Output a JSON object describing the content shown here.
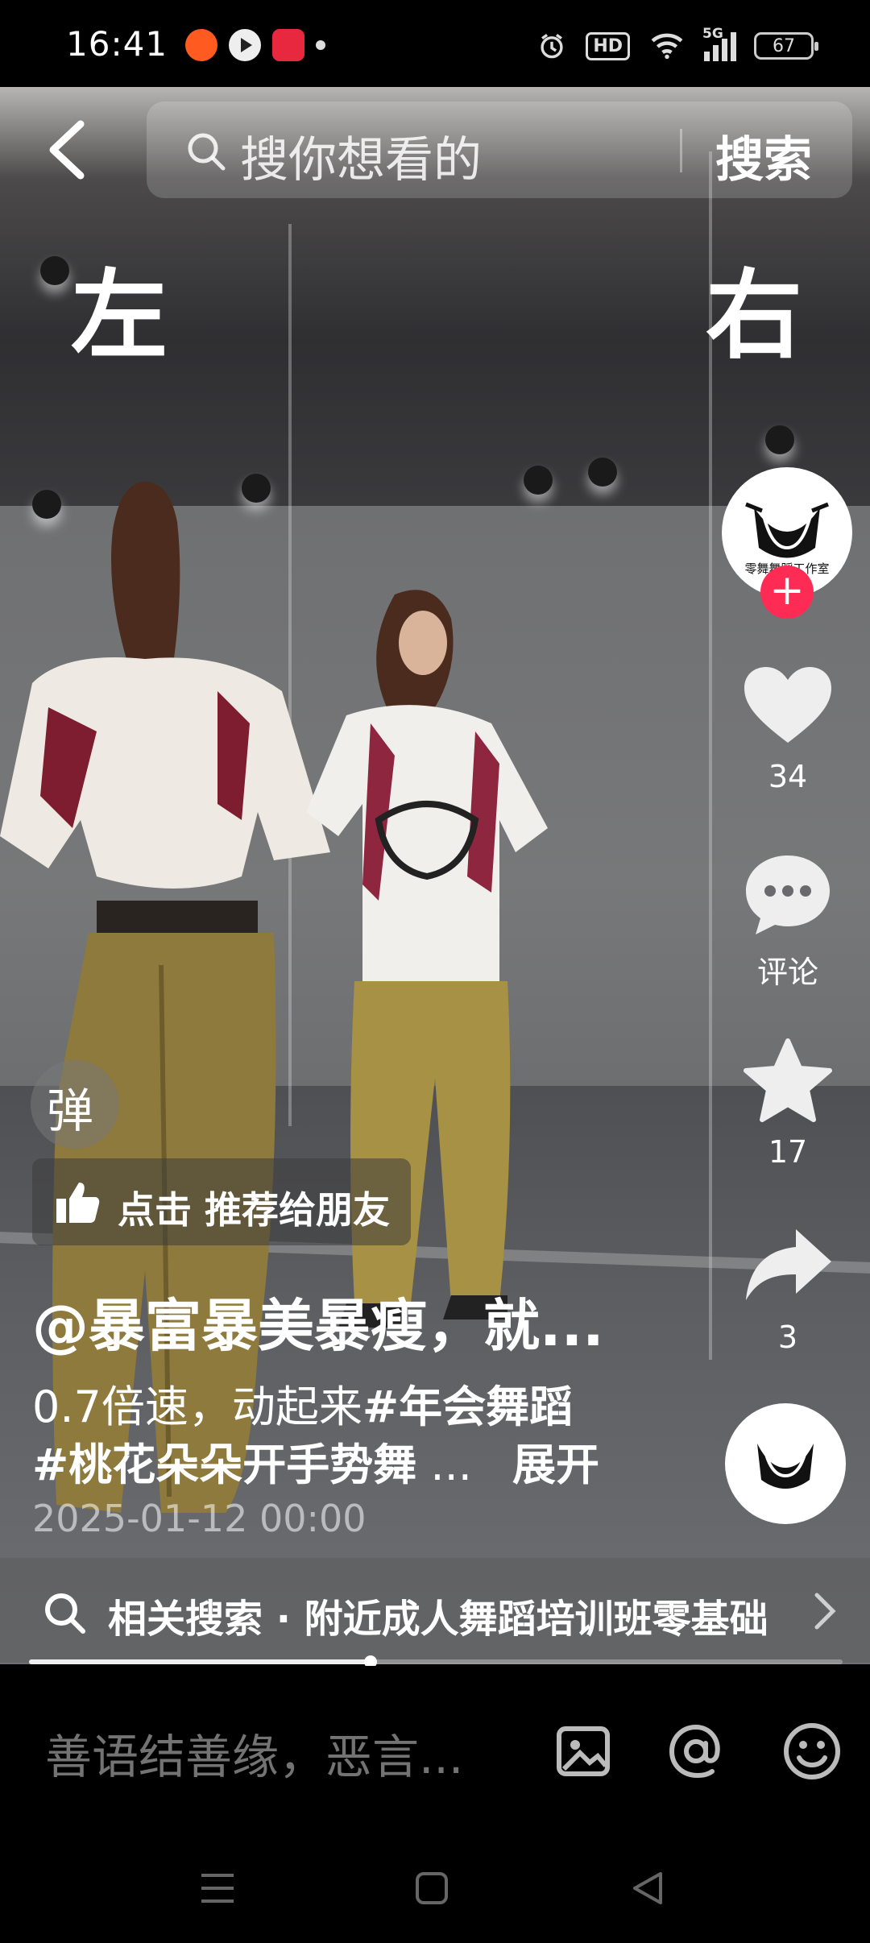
{
  "status_bar": {
    "time": "16:41",
    "battery": "67",
    "network": "5G",
    "hd_label": "HD"
  },
  "search": {
    "placeholder": "搜你想看的",
    "button_label": "搜索"
  },
  "overlay": {
    "left_label": "左",
    "right_label": "右"
  },
  "sidebar": {
    "avatar_caption": "零舞舞蹈工作室",
    "follow_symbol": "+",
    "like_count": "34",
    "comment_label": "评论",
    "favorite_count": "17",
    "share_count": "3"
  },
  "danmaku": {
    "label": "弹"
  },
  "recommend": {
    "label": "点击 推荐给朋友"
  },
  "caption": {
    "author": "@暴富暴美暴瘦，就...",
    "line1_text": "0.7倍速，动起来",
    "line1_tag": "#年会舞蹈",
    "line2_tag": "#桃花朵朵开手势舞",
    "line2_ellipsis": " ...",
    "expand_label": "展开",
    "date": "2025-01-12 00:00"
  },
  "related_search": {
    "label": "相关搜索 · 附近成人舞蹈培训班零基础"
  },
  "progress": {
    "fraction": 0.42
  },
  "comment_bar": {
    "placeholder": "善语结善缘，恶言..."
  },
  "icons": {
    "back": "chevron-left-icon",
    "search": "search-icon",
    "like": "heart-icon",
    "comment": "comment-icon",
    "favorite": "star-icon",
    "share": "share-icon",
    "image": "image-icon",
    "mention": "at-icon",
    "emoji": "emoji-icon"
  },
  "colors": {
    "follow": "#fe2c55",
    "background": "#000000",
    "text": "#ffffff"
  }
}
